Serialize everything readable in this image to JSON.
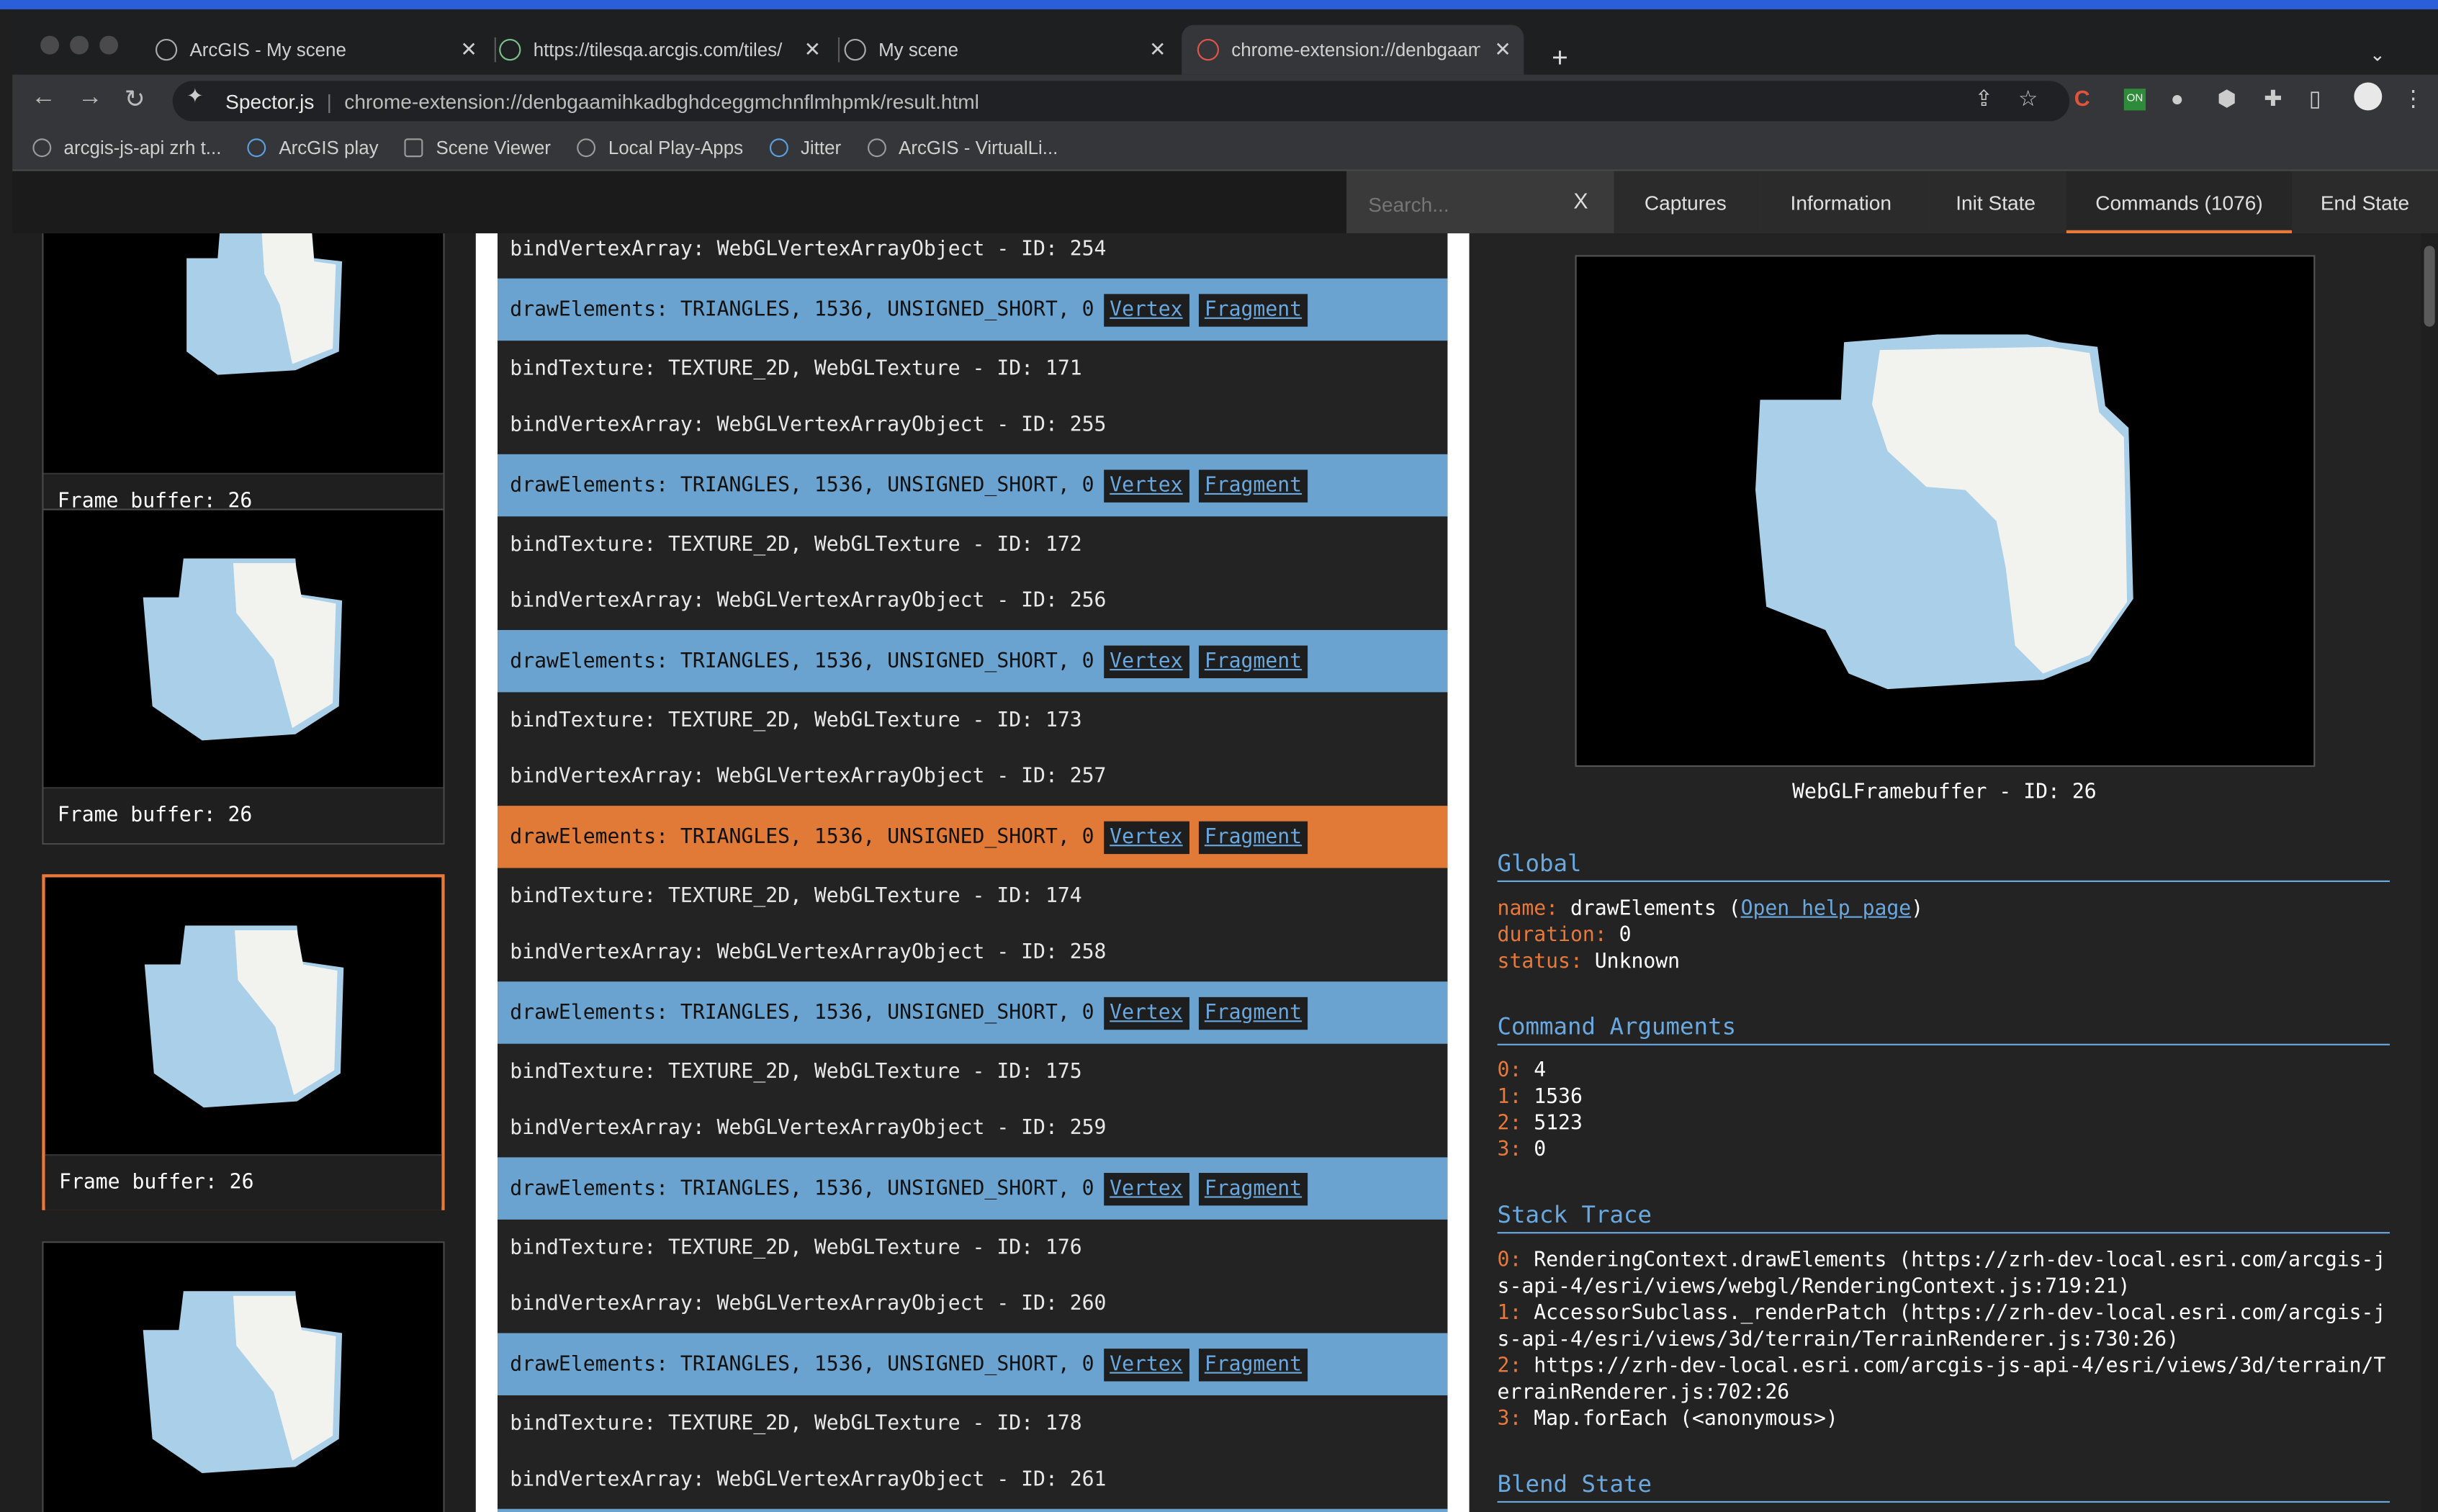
{
  "browser": {
    "tabs": [
      {
        "title": "ArcGIS - My scene",
        "close": "✕"
      },
      {
        "title": "https://tilesqa.arcgis.com/tiles/",
        "close": "✕"
      },
      {
        "title": "My scene",
        "close": "✕"
      },
      {
        "title": "chrome-extension://denbgaam",
        "close": "✕"
      }
    ],
    "new_tab": "+",
    "address": {
      "site": "Spector.js",
      "url": "chrome-extension://denbgaamihkadbghdceggmchnflmhpmk/result.html"
    },
    "bookmarks": [
      "arcgis-js-api zrh t...",
      "ArcGIS play",
      "Scene Viewer",
      "Local Play-Apps",
      "Jitter",
      "ArcGIS - VirtualLi..."
    ]
  },
  "menu": {
    "search_placeholder": "Search...",
    "clear": "X",
    "tabs": [
      "Captures",
      "Information",
      "Init State",
      "Commands (1076)",
      "End State"
    ],
    "active_tab": "Commands (1076)"
  },
  "captures": [
    {
      "label": "Frame buffer: 26",
      "selected": false
    },
    {
      "label": "Frame buffer: 26",
      "selected": false
    },
    {
      "label": "Frame buffer: 26",
      "selected": true
    },
    {
      "label": "",
      "selected": false
    }
  ],
  "commands": [
    {
      "text": "bindVertexArray: WebGLVertexArrayObject - ID: 254",
      "kind": "dark"
    },
    {
      "text": "drawElements: TRIANGLES, 1536, UNSIGNED_SHORT, 0",
      "kind": "draw"
    },
    {
      "text": "bindTexture: TEXTURE_2D, WebGLTexture - ID: 171",
      "kind": "dark"
    },
    {
      "text": "bindVertexArray: WebGLVertexArrayObject - ID: 255",
      "kind": "dark"
    },
    {
      "text": "drawElements: TRIANGLES, 1536, UNSIGNED_SHORT, 0",
      "kind": "draw"
    },
    {
      "text": "bindTexture: TEXTURE_2D, WebGLTexture - ID: 172",
      "kind": "dark"
    },
    {
      "text": "bindVertexArray: WebGLVertexArrayObject - ID: 256",
      "kind": "dark"
    },
    {
      "text": "drawElements: TRIANGLES, 1536, UNSIGNED_SHORT, 0",
      "kind": "draw"
    },
    {
      "text": "bindTexture: TEXTURE_2D, WebGLTexture - ID: 173",
      "kind": "dark"
    },
    {
      "text": "bindVertexArray: WebGLVertexArrayObject - ID: 257",
      "kind": "dark"
    },
    {
      "text": "drawElements: TRIANGLES, 1536, UNSIGNED_SHORT, 0",
      "kind": "current"
    },
    {
      "text": "bindTexture: TEXTURE_2D, WebGLTexture - ID: 174",
      "kind": "dark"
    },
    {
      "text": "bindVertexArray: WebGLVertexArrayObject - ID: 258",
      "kind": "dark"
    },
    {
      "text": "drawElements: TRIANGLES, 1536, UNSIGNED_SHORT, 0",
      "kind": "draw"
    },
    {
      "text": "bindTexture: TEXTURE_2D, WebGLTexture - ID: 175",
      "kind": "dark"
    },
    {
      "text": "bindVertexArray: WebGLVertexArrayObject - ID: 259",
      "kind": "dark"
    },
    {
      "text": "drawElements: TRIANGLES, 1536, UNSIGNED_SHORT, 0",
      "kind": "draw"
    },
    {
      "text": "bindTexture: TEXTURE_2D, WebGLTexture - ID: 176",
      "kind": "dark"
    },
    {
      "text": "bindVertexArray: WebGLVertexArrayObject - ID: 260",
      "kind": "dark"
    },
    {
      "text": "drawElements: TRIANGLES, 1536, UNSIGNED_SHORT, 0",
      "kind": "draw"
    },
    {
      "text": "bindTexture: TEXTURE_2D, WebGLTexture - ID: 178",
      "kind": "dark"
    },
    {
      "text": "bindVertexArray: WebGLVertexArrayObject - ID: 261",
      "kind": "dark"
    },
    {
      "text": "",
      "kind": "draw"
    }
  ],
  "command_buttons": {
    "vertex": "Vertex",
    "fragment": "Fragment"
  },
  "detail": {
    "framebuffer_name": "WebGLFramebuffer - ID: 26",
    "global": {
      "title": "Global",
      "name_key": "name:",
      "name_value": "drawElements (",
      "help_link": "Open help page",
      "name_close": ")",
      "duration_key": "duration:",
      "duration_value": "0",
      "status_key": "status:",
      "status_value": "Unknown"
    },
    "arguments": {
      "title": "Command Arguments",
      "items": [
        {
          "k": "0:",
          "v": "4"
        },
        {
          "k": "1:",
          "v": "1536"
        },
        {
          "k": "2:",
          "v": "5123"
        },
        {
          "k": "3:",
          "v": "0"
        }
      ]
    },
    "stack": {
      "title": "Stack Trace",
      "items": [
        {
          "k": "0:",
          "v": "RenderingContext.drawElements (https://zrh-dev-local.esri.com/arcgis-js-api-4/esri/views/webgl/RenderingContext.js:719:21)"
        },
        {
          "k": "1:",
          "v": "AccessorSubclass._renderPatch (https://zrh-dev-local.esri.com/arcgis-js-api-4/esri/views/3d/terrain/TerrainRenderer.js:730:26)"
        },
        {
          "k": "2:",
          "v": "https://zrh-dev-local.esri.com/arcgis-js-api-4/esri/views/3d/terrain/TerrainRenderer.js:702:26"
        },
        {
          "k": "3:",
          "v": "Map.forEach (<anonymous>)"
        }
      ]
    },
    "blend": {
      "title": "Blend State"
    }
  },
  "colors": {
    "accent_orange": "#e8793a",
    "draw_blue": "#6aa3d0",
    "link_blue": "#6aa8e0"
  }
}
